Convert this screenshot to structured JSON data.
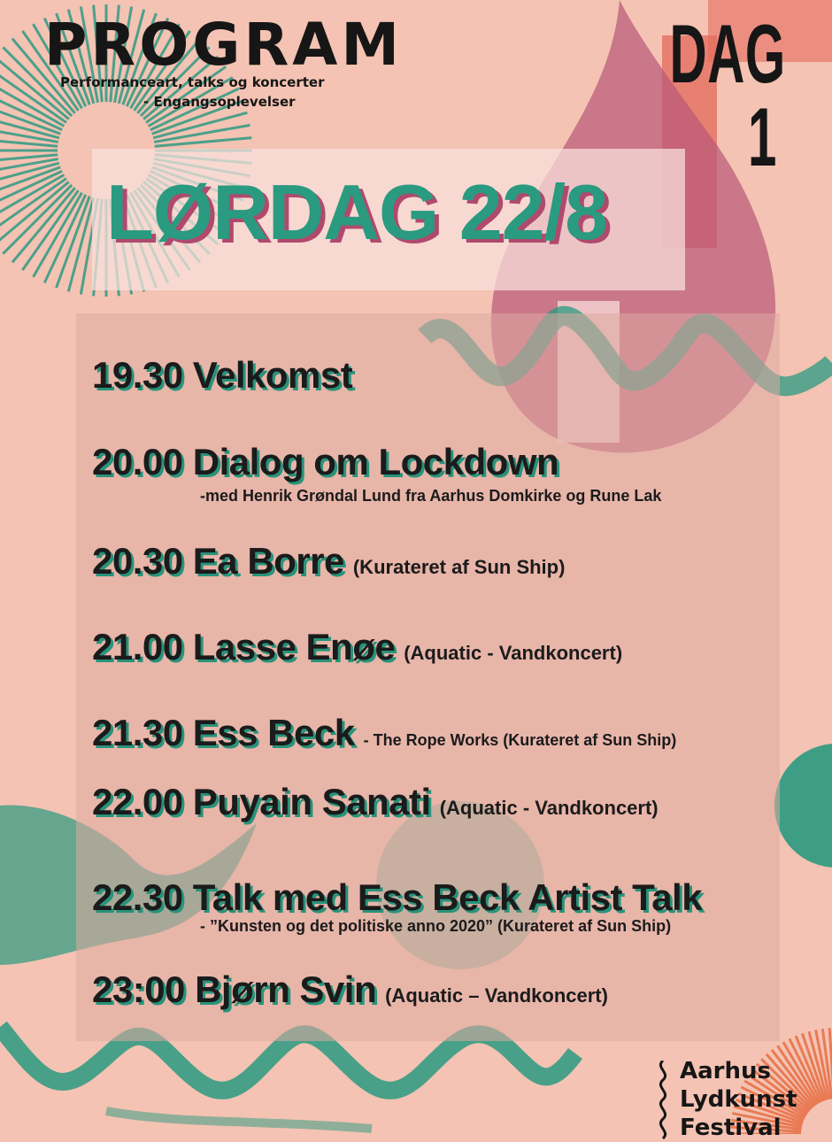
{
  "header": {
    "program": "PROGRAM",
    "subtitle_line1": "Performanceart, talks og koncerter",
    "subtitle_line2": "- Engangsoplevelser",
    "day_label": "DAG 1"
  },
  "title": "LØRDAG 22/8",
  "events": [
    {
      "time_title": "19.30 Velkomst",
      "note": "",
      "detail": ""
    },
    {
      "time_title": "20.00 Dialog om Lockdown",
      "note": "",
      "detail": "-med Henrik Grøndal Lund fra Aarhus Domkirke og Rune Lak"
    },
    {
      "time_title": "20.30 Ea Borre",
      "note": "(Kurateret af Sun Ship)",
      "detail": ""
    },
    {
      "time_title": "21.00 Lasse Enøe",
      "note": "(Aquatic - Vandkoncert)",
      "detail": ""
    },
    {
      "time_title": "21.30 Ess Beck",
      "note": "- The Rope Works (Kurateret af Sun Ship)",
      "detail": ""
    },
    {
      "time_title": "22.00 Puyain Sanati",
      "note": "(Aquatic - Vandkoncert)",
      "detail": ""
    },
    {
      "time_title": "22.30 Talk med Ess Beck Artist Talk",
      "note": "",
      "detail": "- ”Kunsten og det politiske anno 2020” (Kurateret af Sun Ship)"
    },
    {
      "time_title": "23:00 Bjørn Svin",
      "note": "(Aquatic – Vandkoncert)",
      "detail": ""
    }
  ],
  "festival_logo": {
    "line1": "Aarhus",
    "line2": "Lydkunst",
    "line3": "Festival"
  },
  "colors": {
    "background": "#f4c3b3",
    "teal": "#2a9a80",
    "magenta": "#b04a6d",
    "ink": "#161616",
    "red": "#e46a5c",
    "orange": "#e8734a"
  }
}
